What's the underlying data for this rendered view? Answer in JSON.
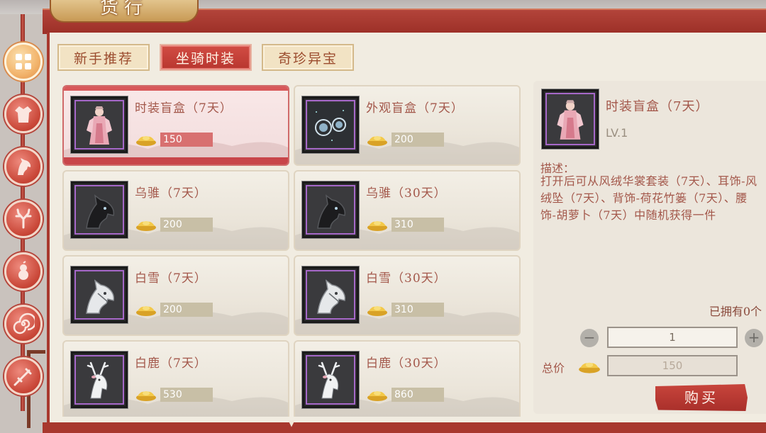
{
  "window": {
    "title": "货行"
  },
  "tabs": [
    {
      "label": "新手推荐",
      "active": false
    },
    {
      "label": "坐骑时装",
      "active": true
    },
    {
      "label": "奇珍异宝",
      "active": false
    }
  ],
  "side_nav": [
    {
      "icon": "grid-icon",
      "active": true
    },
    {
      "icon": "robe-icon",
      "active": false
    },
    {
      "icon": "horse-icon",
      "active": false
    },
    {
      "icon": "antler-icon",
      "active": false
    },
    {
      "icon": "gourd-icon",
      "active": false
    },
    {
      "icon": "swirl-icon",
      "active": false
    },
    {
      "icon": "sword-icon",
      "active": false
    }
  ],
  "items": [
    {
      "name": "时装盲盒（7天）",
      "price": "150",
      "icon": "costume-box-icon",
      "selected": true
    },
    {
      "name": "外观盲盒（7天）",
      "price": "200",
      "icon": "appearance-box-icon",
      "selected": false
    },
    {
      "name": "乌骓（7天）",
      "price": "200",
      "icon": "black-horse-icon",
      "selected": false
    },
    {
      "name": "乌骓（30天）",
      "price": "310",
      "icon": "black-horse-icon",
      "selected": false
    },
    {
      "name": "白雪（7天）",
      "price": "200",
      "icon": "white-horse-icon",
      "selected": false
    },
    {
      "name": "白雪（30天）",
      "price": "310",
      "icon": "white-horse-icon",
      "selected": false
    },
    {
      "name": "白鹿（7天）",
      "price": "530",
      "icon": "white-deer-icon",
      "selected": false
    },
    {
      "name": "白鹿（30天）",
      "price": "860",
      "icon": "white-deer-icon",
      "selected": false
    }
  ],
  "detail": {
    "name": "时装盲盒（7天）",
    "level": "LV.1",
    "desc_label": "描述：",
    "description": "打开后可从风绒华裳套装（7天）、耳饰-风绒坠（7天）、背饰-荷花竹篓（7天）、腰饰-胡萝卜（7天）中随机获得一件",
    "owned": "已拥有0个",
    "quantity": "1",
    "total_label": "总价",
    "total": "150",
    "buy_label": "购买"
  },
  "colors": {
    "accent": "#c8453c",
    "frame": "#a8382e",
    "text": "#a3574a",
    "panel": "#f1ece1"
  }
}
